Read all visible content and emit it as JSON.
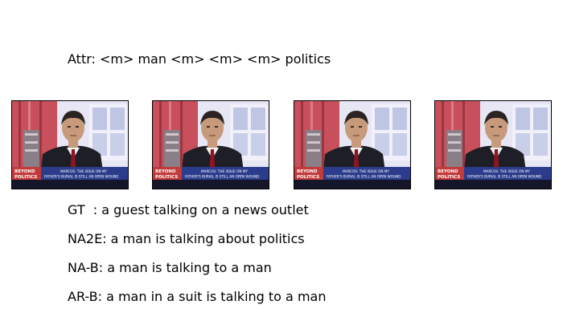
{
  "attributes": {
    "line": "Attr: <m> man <m> <m> <m> politics"
  },
  "frames": {
    "count": 4,
    "banner_logo_line1": "BEYOND",
    "banner_logo_line2": "POLITICS",
    "banner_caption_line1": "MARCOS: THE ISSUE ON MY",
    "banner_caption_line2": "FATHER'S BURIAL IS STILL AN OPEN WOUND"
  },
  "captions": {
    "gt": "GT  : a guest talking on a news outlet",
    "na2e": "NA2E: a man is talking about politics",
    "na_b": "NA-B: a man is talking to a man",
    "ar_b": "AR-B: a man in a suit is talking to a man"
  },
  "colors": {
    "studio_red": "#c8505c",
    "studio_window": "#e6e6f4",
    "suit": "#1e1e26",
    "tie": "#8e1422",
    "skin": "#c79a7c",
    "banner_blue": "#2b3c8c",
    "banner_red": "#c23a3a"
  }
}
